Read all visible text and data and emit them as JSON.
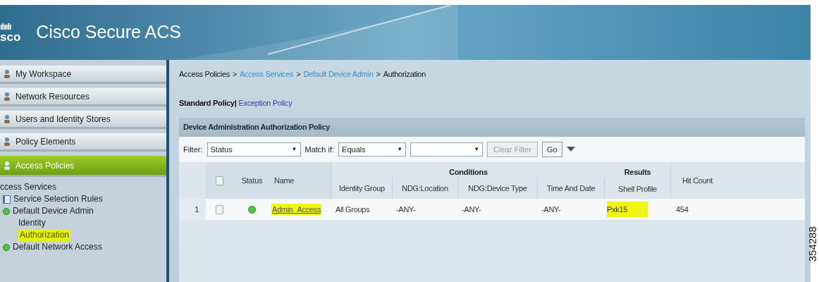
{
  "header": {
    "logo_bars": "ılıılı",
    "logo_text": "sco",
    "title": "Cisco Secure ACS"
  },
  "sidebar": {
    "items": [
      {
        "label": "My Workspace",
        "selected": false
      },
      {
        "label": "Network Resources",
        "selected": false
      },
      {
        "label": "Users and Identity Stores",
        "selected": false
      },
      {
        "label": "Policy Elements",
        "selected": false
      },
      {
        "label": "Access Policies",
        "selected": true
      }
    ],
    "tree": [
      {
        "label": "ccess Services",
        "highlighted": false,
        "children": [
          {
            "label": "Service Selection Rules",
            "kind": "rules",
            "highlighted": false
          },
          {
            "label": "Default Device Admin",
            "kind": "service",
            "highlighted": false,
            "children": [
              {
                "label": "Identity",
                "kind": "plain",
                "highlighted": false
              },
              {
                "label": "Authorization",
                "kind": "plain",
                "highlighted": true
              }
            ]
          },
          {
            "label": "Default Network Access",
            "kind": "service",
            "highlighted": false
          }
        ]
      }
    ]
  },
  "breadcrumb": [
    {
      "label": "Access Policies",
      "link": false
    },
    {
      "label": "Access Services",
      "link": true
    },
    {
      "label": "Default Device Admin",
      "link": true
    },
    {
      "label": "Authorization",
      "link": false
    }
  ],
  "breadcrumb_separator": ">",
  "policy_tabs": [
    {
      "label": "Standard Policy|",
      "selected": true
    },
    {
      "label": "Exception Policy",
      "selected": false
    }
  ],
  "panel": {
    "title": "Device Administration Authorization Policy",
    "filter": {
      "label": "Filter:",
      "field": "Status",
      "match_label": "Match if:",
      "match": "Equals",
      "dropdown_caret": "▼",
      "clear_button": "Clear Filter",
      "go_button": "Go"
    },
    "select_all_checked": false,
    "groups": {
      "conditions": "Conditions",
      "results": "Results"
    },
    "columns": [
      "Status",
      "Name",
      "Identity Group",
      "NDG:Location",
      "NDG:Device Type",
      "Time And Date",
      "Shell Profile",
      "Hit Count"
    ],
    "rows": [
      {
        "number": "1",
        "checked": false,
        "status_on": true,
        "name": "Admin_Access",
        "name_highlighted": true,
        "identity_group": "All Groups",
        "ndg_location": "-ANY-",
        "ndg_device_type": "-ANY-",
        "time_and_date": "-ANY-",
        "shell_profile": "Pxk15",
        "shell_highlighted": true,
        "hit_count": "454"
      }
    ]
  },
  "figure_number": "354288"
}
